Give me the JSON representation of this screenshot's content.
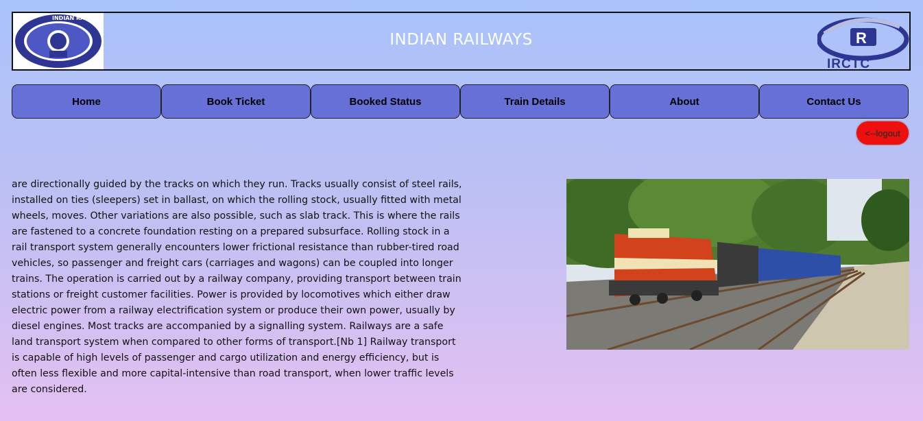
{
  "header": {
    "title": "INDIAN RAILWAYS",
    "left_logo": {
      "icon": "indian-railways-emblem-icon",
      "text": "INDIAN RAILWAYS"
    },
    "right_logo": {
      "icon": "irctc-logo-icon",
      "text": "IRCTC"
    }
  },
  "nav": {
    "items": [
      {
        "label": "Home"
      },
      {
        "label": "Book Ticket"
      },
      {
        "label": "Booked Status"
      },
      {
        "label": "Train Details"
      },
      {
        "label": "About"
      },
      {
        "label": "Contact Us"
      }
    ]
  },
  "logout": {
    "label": "<--logout"
  },
  "article": {
    "text": "are directionally guided by the tracks on which they run. Tracks usually consist of steel rails, installed on ties (sleepers) set in ballast, on which the rolling stock, usually fitted with metal wheels, moves. Other variations are also possible, such as slab track. This is where the rails are fastened to a concrete foundation resting on a prepared subsurface. Rolling stock in a rail transport system generally encounters lower frictional resistance than rubber-tired road vehicles, so passenger and freight cars (carriages and wagons) can be coupled into longer trains. The operation is carried out by a railway company, providing transport between train stations or freight customer facilities. Power is provided by locomotives which either draw electric power from a railway electrification system or produce their own power, usually by diesel engines. Most tracks are accompanied by a signalling system. Railways are a safe land transport system when compared to other forms of transport.[Nb 1] Railway transport is capable of high levels of passenger and cargo utilization and energy efficiency, but is often less flexible and more capital-intensive than road transport, when lower traffic levels are considered."
  },
  "colors": {
    "nav_bg": "#6670d6",
    "logout_bg": "#ee0f0f",
    "title_text": "#ffffff",
    "logo_blue": "#2e3592"
  }
}
